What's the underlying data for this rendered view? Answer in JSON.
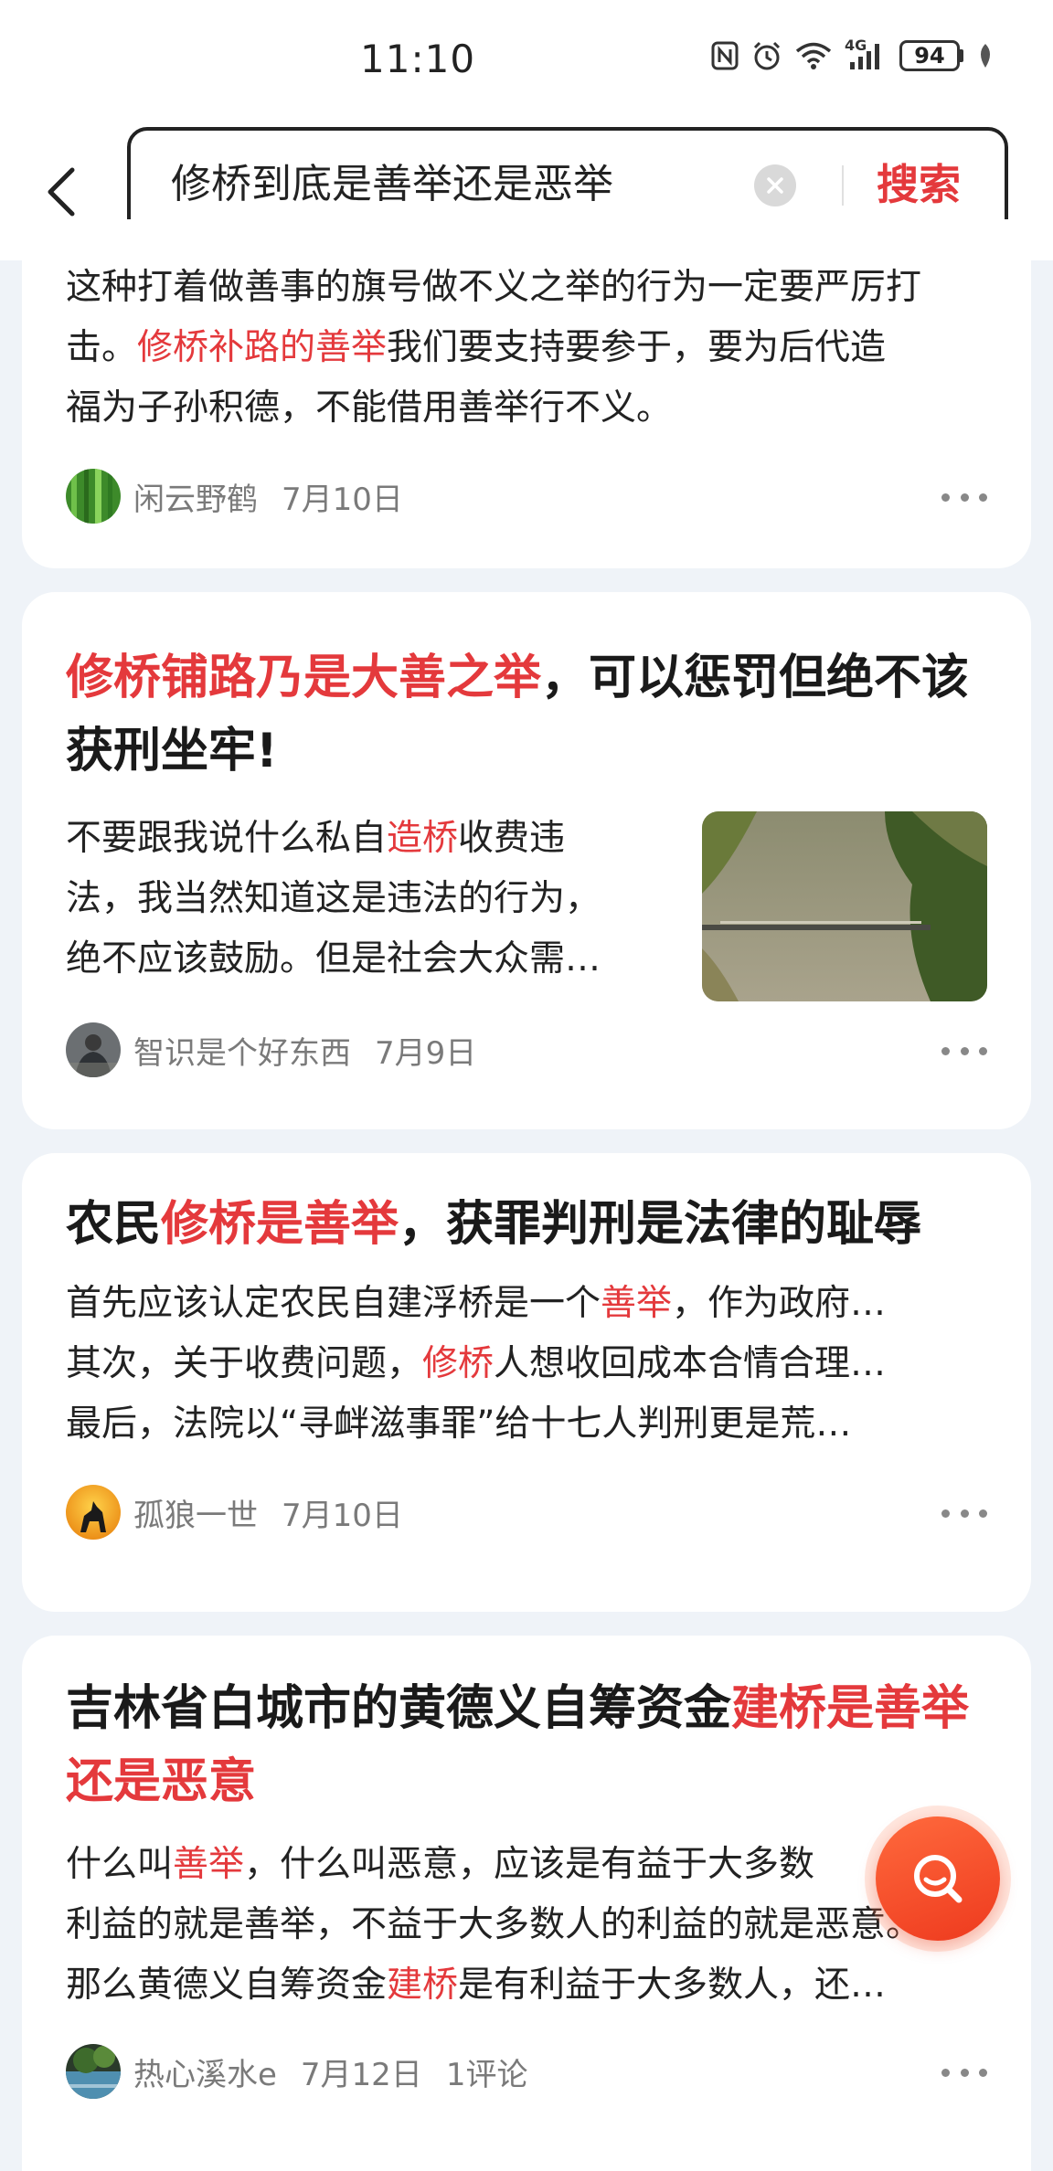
{
  "status_bar": {
    "time": "11:10",
    "battery": "94",
    "network": "4G"
  },
  "search": {
    "query": "修桥到底是善举还是恶举",
    "button_label": "搜索"
  },
  "results": [
    {
      "body_lines": [
        [
          "这种打着做善事的旗号做不义之举的行为一定要严厉打"
        ],
        [
          "击。",
          "修桥补路的善举",
          "我们要支持要参于，要为后代造"
        ],
        [
          "福为子孙积德，不能借用善举行不义。"
        ]
      ],
      "author": "闲云野鹤",
      "date": "7月10日"
    },
    {
      "title_parts": [
        "修桥铺路乃是大善之举",
        "，可以惩罚但绝不该获刑坐牢!"
      ],
      "body_lines": [
        [
          "不要跟我说什么私自",
          "造桥",
          "收费违"
        ],
        [
          "法，我当然知道这是违法的行为，"
        ],
        [
          "绝不应该鼓励。但是社会大众需…"
        ]
      ],
      "author": "智识是个好东西",
      "date": "7月9日"
    },
    {
      "title_parts": [
        "农民",
        "修桥是善举",
        "，获罪判刑是法律的耻辱"
      ],
      "body_lines": [
        [
          "首先应该认定农民自建浮桥是一个",
          "善举",
          "，作为政府…"
        ],
        [
          "其次，关于收费问题，",
          "修桥",
          "人想收回成本合情合理…"
        ],
        [
          "最后，法院以“寻衅滋事罪”给十七人判刑更是荒…"
        ]
      ],
      "author": "孤狼一世",
      "date": "7月10日"
    },
    {
      "title_parts": [
        "吉林省白城市的黄德义自筹资金",
        "建桥是善举还是恶意"
      ],
      "body_lines": [
        [
          "什么叫",
          "善举",
          "，什么叫恶意，应该是有益于大多数"
        ],
        [
          "利益的就是善举，不益于大多数人的利益的就是恶意。"
        ],
        [
          "那么黄德义自筹资金",
          "建桥",
          "是有利益于大多数人，还…"
        ]
      ],
      "author": "热心溪水e",
      "date": "7月12日",
      "comments": "1评论"
    }
  ],
  "colors": {
    "highlight": "#e4393c",
    "background": "#eff3f8",
    "card": "#ffffff"
  }
}
